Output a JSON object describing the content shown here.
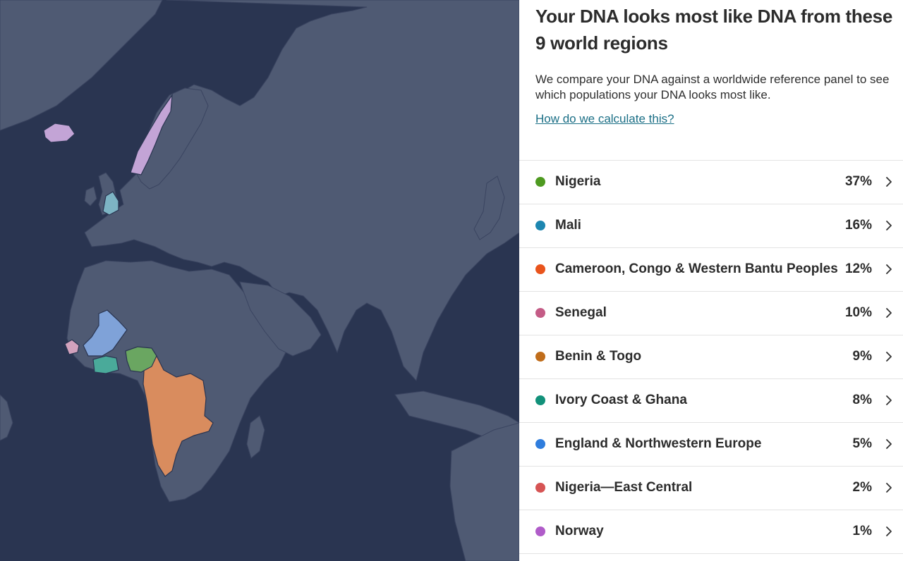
{
  "panel": {
    "title": "Your DNA looks most like DNA from these 9 world regions",
    "description": "We compare your DNA against a worldwide reference panel to see which populations your DNA looks most like.",
    "help_link": "How do we calculate this?"
  },
  "regions": [
    {
      "name": "Nigeria",
      "percent": "37%",
      "color": "#4e9a21"
    },
    {
      "name": "Mali",
      "percent": "16%",
      "color": "#1d86b0"
    },
    {
      "name": "Cameroon, Congo & Western Bantu Peoples",
      "percent": "12%",
      "color": "#e9541c"
    },
    {
      "name": "Senegal",
      "percent": "10%",
      "color": "#c45c86"
    },
    {
      "name": "Benin & Togo",
      "percent": "9%",
      "color": "#c06d1b"
    },
    {
      "name": "Ivory Coast & Ghana",
      "percent": "8%",
      "color": "#12917a"
    },
    {
      "name": "England & Northwestern Europe",
      "percent": "5%",
      "color": "#2f7ddd"
    },
    {
      "name": "Nigeria—East Central",
      "percent": "2%",
      "color": "#d65454"
    },
    {
      "name": "Norway",
      "percent": "1%",
      "color": "#b05cc9"
    }
  ],
  "map": {
    "ocean_color": "#2a3551",
    "land_color": "#4f5a73",
    "highlight_colors": {
      "west_central_africa": "#d98c5e",
      "nigeria": "#6aa661",
      "mali": "#7fa2d8",
      "ivory_coast_ghana": "#4aaa9a",
      "senegal": "#d2a2bd",
      "england": "#7db4c4",
      "norway_iceland": "#c3a4d6"
    }
  }
}
